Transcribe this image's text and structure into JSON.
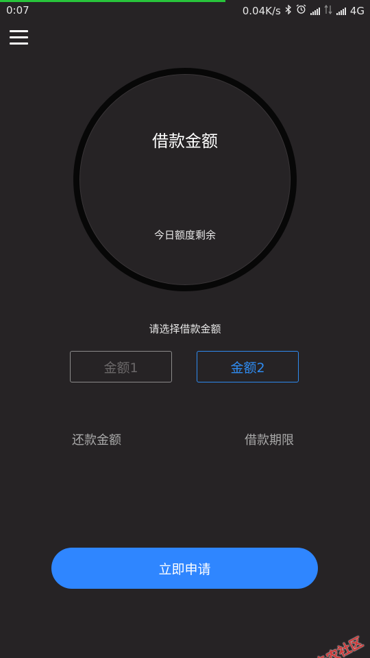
{
  "status_bar": {
    "time": "0:07",
    "speed": "0.04K/s",
    "network": "4G",
    "icons": [
      "bluetooth-icon",
      "alarm-icon",
      "signal-icon",
      "data-arrows-icon",
      "signal-icon"
    ]
  },
  "header": {
    "menu_icon": "hamburger-menu-icon"
  },
  "ring": {
    "title": "借款金额",
    "subtitle": "今日额度剩余"
  },
  "amount_select": {
    "label": "请选择借款金额",
    "options": [
      {
        "label": "金额1",
        "selected": false
      },
      {
        "label": "金额2",
        "selected": true
      }
    ]
  },
  "info": {
    "repay_amount_label": "还款金额",
    "loan_term_label": "借款期限"
  },
  "apply_button": {
    "label": "立即申请"
  },
  "watermark": {
    "text": "卡农社区"
  },
  "colors": {
    "background": "#262325",
    "accent": "#2f86ff",
    "selected_border": "#2f8cf2",
    "ring": "#070707",
    "progress": "#28c43b"
  }
}
